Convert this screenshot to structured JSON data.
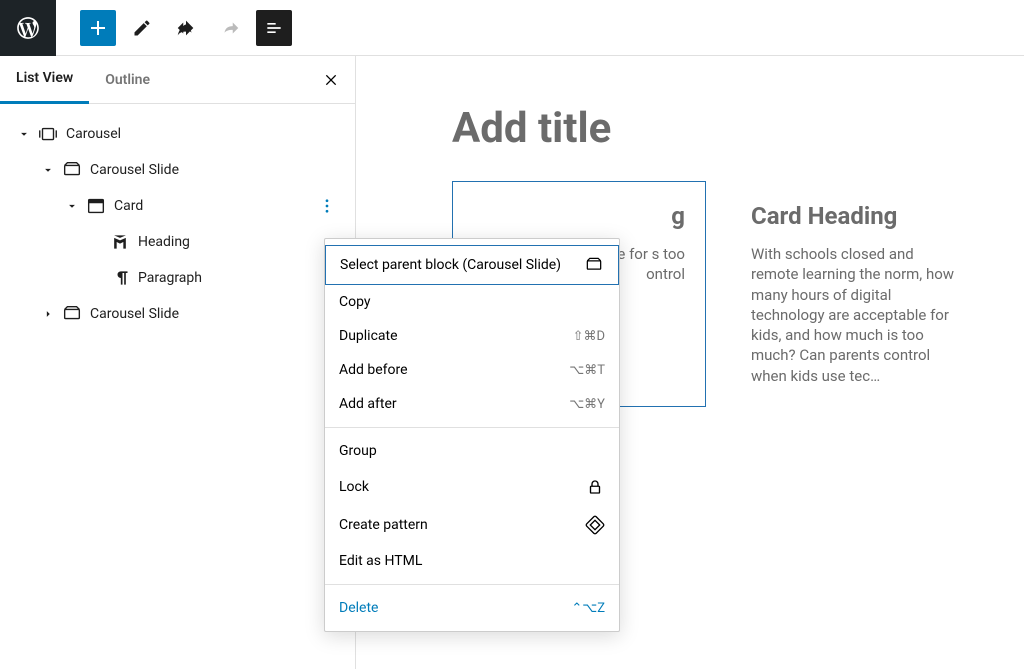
{
  "toolbar": {
    "add": "+",
    "edit": "edit",
    "undo": "undo",
    "redo": "redo",
    "doc": "doc-outline"
  },
  "sidebar": {
    "tabs": {
      "listview": "List View",
      "outline": "Outline"
    },
    "tree": [
      {
        "label": "Carousel",
        "depth": 0,
        "icon": "carousel",
        "chev": "down"
      },
      {
        "label": "Carousel Slide",
        "depth": 1,
        "icon": "slide",
        "chev": "down"
      },
      {
        "label": "Card",
        "depth": 2,
        "icon": "card",
        "chev": "down",
        "more": true
      },
      {
        "label": "Heading",
        "depth": 3,
        "icon": "heading",
        "chev": ""
      },
      {
        "label": "Paragraph",
        "depth": 3,
        "icon": "paragraph",
        "chev": ""
      },
      {
        "label": "Carousel Slide",
        "depth": 1,
        "icon": "slide",
        "chev": "right"
      }
    ]
  },
  "canvas": {
    "title_placeholder": "Add title",
    "card1": {
      "heading": "g",
      "body": "and orm, igital table for s too ontrol"
    },
    "card2": {
      "heading": "Card Heading",
      "body": "With schools closed and remote learning the norm, how many hours of digital technology are acceptable for kids, and how much is too much? Can parents control when kids use tec…"
    }
  },
  "menu": {
    "select_parent": "Select parent block (Carousel Slide)",
    "copy": "Copy",
    "duplicate": "Duplicate",
    "duplicate_kb": "⇧⌘D",
    "add_before": "Add before",
    "add_before_kb": "⌥⌘T",
    "add_after": "Add after",
    "add_after_kb": "⌥⌘Y",
    "group": "Group",
    "lock": "Lock",
    "create_pattern": "Create pattern",
    "edit_html": "Edit as HTML",
    "delete": "Delete",
    "delete_kb": "⌃⌥Z"
  }
}
